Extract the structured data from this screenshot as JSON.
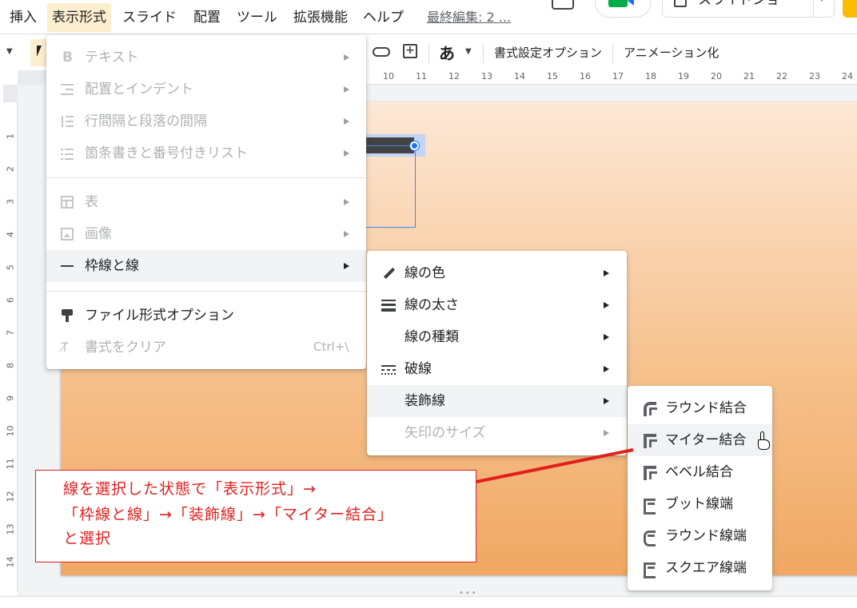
{
  "menubar": {
    "items": [
      "挿入",
      "表示形式",
      "スライド",
      "配置",
      "ツール",
      "拡張機能",
      "ヘルプ"
    ],
    "last_edit": "最終編集: 2 ...",
    "slideshow_label": "スライドショー"
  },
  "toolbar": {
    "format_options": "書式設定オプション",
    "animate": "アニメーション化",
    "kana": "あ"
  },
  "ruler": {
    "h": [
      "10",
      "11",
      "12",
      "13",
      "14",
      "15",
      "16",
      "17",
      "18",
      "19",
      "20",
      "21",
      "22",
      "23",
      "24"
    ],
    "v": [
      "1",
      "2",
      "3",
      "4",
      "5",
      "6",
      "7",
      "8",
      "9",
      "10",
      "11",
      "12",
      "13",
      "14"
    ]
  },
  "format_menu": {
    "items": [
      {
        "label": "テキスト",
        "icon": "bold-icon",
        "enabled": false,
        "submenu": true
      },
      {
        "label": "配置とインデント",
        "icon": "indent-icon",
        "enabled": false,
        "submenu": true
      },
      {
        "label": "行間隔と段落の間隔",
        "icon": "line-spacing-icon",
        "enabled": false,
        "submenu": true
      },
      {
        "label": "箇条書きと番号付きリスト",
        "icon": "list-icon",
        "enabled": false,
        "submenu": true
      },
      {
        "label": "表",
        "icon": "table-icon",
        "enabled": false,
        "submenu": true
      },
      {
        "label": "画像",
        "icon": "image-icon",
        "enabled": false,
        "submenu": true
      },
      {
        "label": "枠線と線",
        "icon": "border-icon",
        "enabled": true,
        "submenu": true,
        "highlighted": true
      },
      {
        "label": "ファイル形式オプション",
        "icon": "paint-format-icon",
        "enabled": true
      },
      {
        "label": "書式をクリア",
        "icon": "clear-format-icon",
        "enabled": false,
        "shortcut": "Ctrl+\\"
      }
    ]
  },
  "border_menu": {
    "items": [
      {
        "label": "線の色",
        "icon": "pencil-icon",
        "enabled": true
      },
      {
        "label": "線の太さ",
        "icon": "line-weight-icon",
        "enabled": true
      },
      {
        "label": "線の種類",
        "enabled": true
      },
      {
        "label": "破線",
        "icon": "dash-icon",
        "enabled": true
      },
      {
        "label": "装飾線",
        "enabled": true,
        "highlighted": true
      },
      {
        "label": "矢印のサイズ",
        "enabled": false
      }
    ]
  },
  "decor_menu": {
    "items": [
      {
        "label": "ラウンド結合",
        "icon": "round-join-icon"
      },
      {
        "label": "マイター結合",
        "icon": "miter-join-icon",
        "highlighted": true
      },
      {
        "label": "ベベル結合",
        "icon": "bevel-join-icon"
      },
      {
        "label": "ブット線端",
        "icon": "butt-cap-icon"
      },
      {
        "label": "ラウンド線端",
        "icon": "round-cap-icon"
      },
      {
        "label": "スクエア線端",
        "icon": "square-cap-icon"
      }
    ]
  },
  "annotation": {
    "lines": [
      "線を選択した状態で「表示形式」→",
      "「枠線と線」→「装飾線」→「マイター結合」",
      "と選択"
    ],
    "color": "#e02020"
  },
  "colors": {
    "menu_highlight": "#f1f3f4",
    "active_menu": "#fcefcf",
    "selection": "#1a73e8",
    "slide_top": "#fde8d6",
    "slide_bottom": "#f0a863"
  }
}
